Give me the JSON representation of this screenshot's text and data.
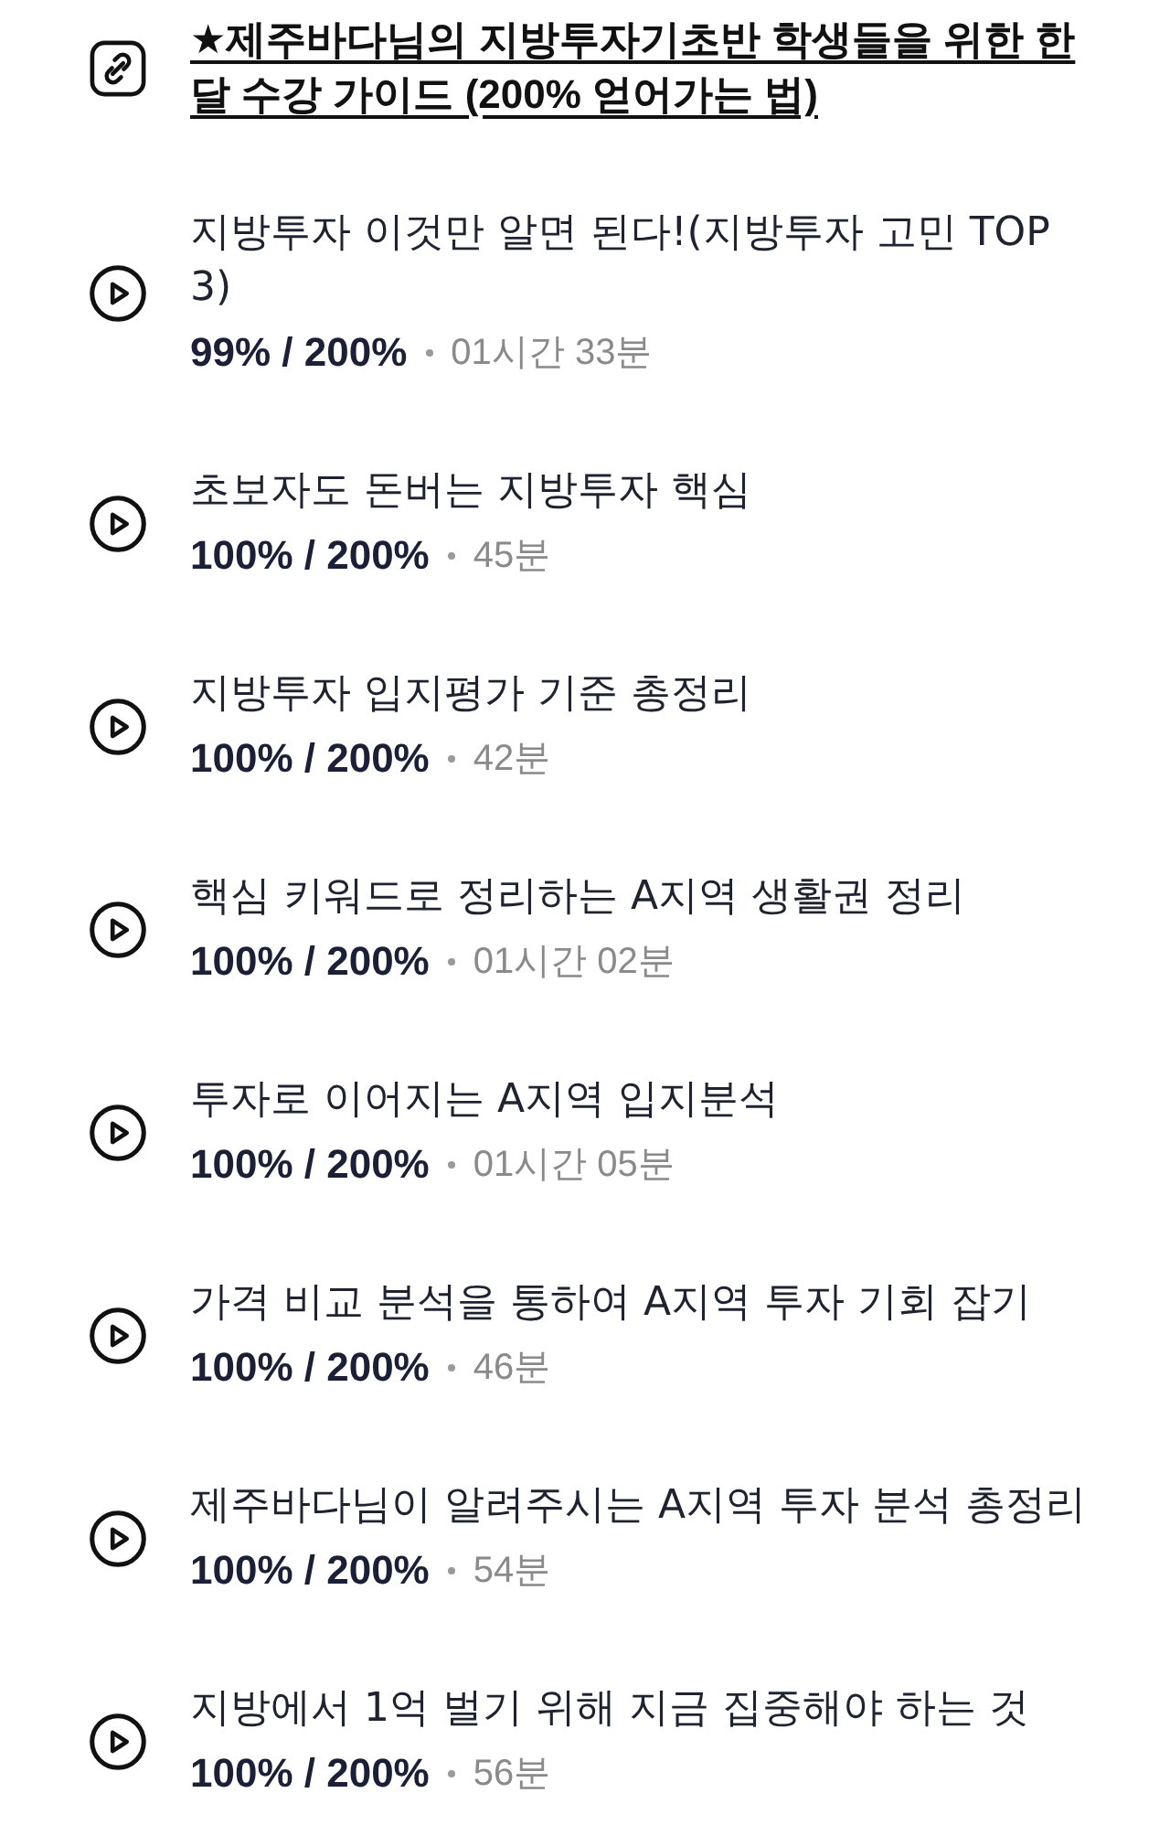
{
  "items": [
    {
      "kind": "link",
      "title": "★제주바다님의 지방투자기초반 학생들을 위한 한 달 수강 가이드 (200% 얻어가는 법)"
    },
    {
      "kind": "video",
      "title": "지방투자 이것만 알면 된다!(지방투자 고민 TOP 3)",
      "progress": "99% / 200%",
      "duration": "01시간 33분"
    },
    {
      "kind": "video",
      "title": "초보자도 돈버는 지방투자 핵심",
      "progress": "100% / 200%",
      "duration": "45분"
    },
    {
      "kind": "video",
      "title": "지방투자 입지평가 기준 총정리",
      "progress": "100% / 200%",
      "duration": "42분"
    },
    {
      "kind": "video",
      "title": "핵심 키워드로 정리하는 A지역 생활권 정리",
      "progress": "100% / 200%",
      "duration": "01시간 02분"
    },
    {
      "kind": "video",
      "title": "투자로 이어지는 A지역 입지분석",
      "progress": "100% / 200%",
      "duration": "01시간 05분"
    },
    {
      "kind": "video",
      "title": "가격 비교 분석을 통하여 A지역 투자 기회 잡기",
      "progress": "100% / 200%",
      "duration": "46분"
    },
    {
      "kind": "video",
      "title": "제주바다님이 알려주시는 A지역 투자 분석 총정리",
      "progress": "100% / 200%",
      "duration": "54분"
    },
    {
      "kind": "video",
      "title": "지방에서 1억 벌기 위해 지금 집중해야 하는 것",
      "progress": "100% / 200%",
      "duration": "56분"
    }
  ]
}
